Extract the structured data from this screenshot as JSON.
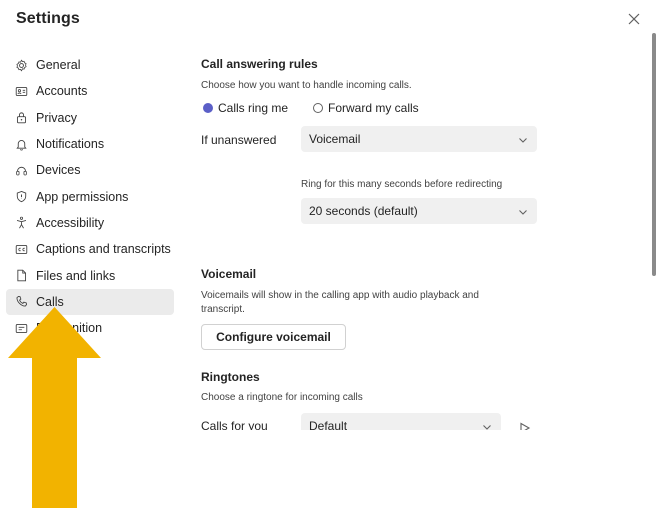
{
  "window": {
    "title": "Settings",
    "close_icon": "close-icon"
  },
  "sidebar": {
    "items": [
      {
        "label": "General",
        "icon": "gear-icon"
      },
      {
        "label": "Accounts",
        "icon": "id-card-icon"
      },
      {
        "label": "Privacy",
        "icon": "lock-icon"
      },
      {
        "label": "Notifications",
        "icon": "bell-icon"
      },
      {
        "label": "Devices",
        "icon": "devices-icon"
      },
      {
        "label": "App permissions",
        "icon": "shield-icon"
      },
      {
        "label": "Accessibility",
        "icon": "accessibility-icon"
      },
      {
        "label": "Captions and transcripts",
        "icon": "captions-icon"
      },
      {
        "label": "Files and links",
        "icon": "file-icon"
      },
      {
        "label": "Calls",
        "icon": "phone-icon",
        "active": true
      },
      {
        "label": "Recognition",
        "icon": "recognition-icon"
      }
    ]
  },
  "call_answering": {
    "heading": "Call answering rules",
    "description": "Choose how you want to handle incoming calls.",
    "options": [
      {
        "label": "Calls ring me",
        "selected": true
      },
      {
        "label": "Forward my calls",
        "selected": false
      }
    ],
    "if_unanswered_label": "If unanswered",
    "if_unanswered_value": "Voicemail",
    "ring_label": "Ring for this many seconds before redirecting",
    "ring_value": "20 seconds (default)"
  },
  "voicemail": {
    "heading": "Voicemail",
    "description": "Voicemails will show in the calling app with audio playback and transcript.",
    "button_label": "Configure voicemail"
  },
  "ringtones": {
    "heading": "Ringtones",
    "description": "Choose a ringtone for incoming calls",
    "calls_for_you_label": "Calls for you",
    "calls_for_you_value": "Default"
  },
  "colors": {
    "accent": "#5b5fc7",
    "active_bg": "#ebebeb",
    "annotation_arrow": "#f2b300"
  }
}
